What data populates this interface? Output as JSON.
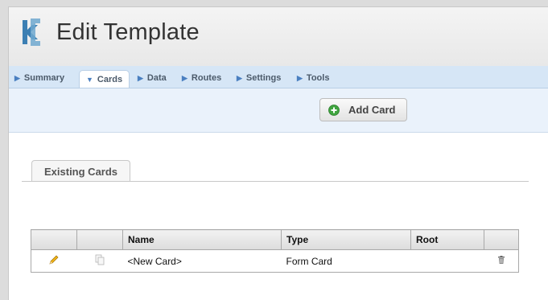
{
  "header": {
    "title": "Edit Template"
  },
  "tabs": [
    {
      "label": "Summary",
      "active": false
    },
    {
      "label": "Cards",
      "active": true
    },
    {
      "label": "Data",
      "active": false
    },
    {
      "label": "Routes",
      "active": false
    },
    {
      "label": "Settings",
      "active": false
    },
    {
      "label": "Tools",
      "active": false
    }
  ],
  "toolbar": {
    "add_card_label": "Add Card"
  },
  "section": {
    "tab_label": "Existing Cards"
  },
  "table": {
    "columns": [
      "",
      "",
      "Name",
      "Type",
      "Root",
      ""
    ],
    "rows": [
      {
        "name": "<New Card>",
        "type": "Form Card",
        "root": ""
      }
    ]
  },
  "colors": {
    "accent": "#4a7fc0",
    "tabbar_bg": "#d6e6f6",
    "add_icon_green": "#3fa43f"
  }
}
